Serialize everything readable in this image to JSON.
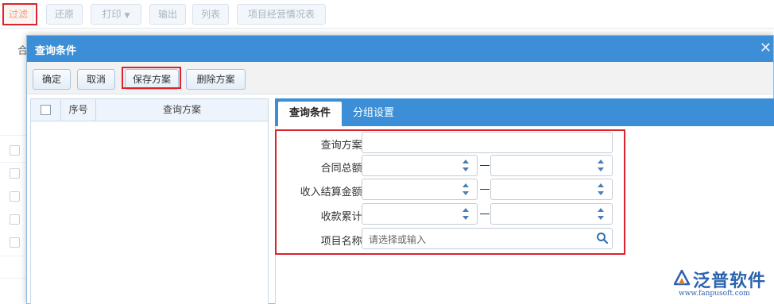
{
  "toolbar": {
    "filter": "过滤",
    "restore": "还原",
    "print": "打印",
    "export": "输出",
    "list": "列表",
    "report": "项目经营情况表"
  },
  "background": {
    "partial_text": "合"
  },
  "dialog": {
    "title": "查询条件",
    "buttons": {
      "confirm": "确定",
      "cancel": "取消",
      "save_scheme": "保存方案",
      "delete_scheme": "删除方案"
    },
    "left_table": {
      "columns": [
        "序号",
        "查询方案"
      ]
    },
    "tabs": [
      "查询条件",
      "分组设置"
    ],
    "active_tab": "查询条件",
    "form": {
      "scheme_label": "查询方案:",
      "scheme_value": "",
      "contract_total_label": "合同总额:",
      "income_settlement_label": "收入结算金额:",
      "collection_total_label": "收款累计:",
      "range_separator": "—",
      "project_name_label": "项目名称:",
      "project_name_placeholder": "请选择或输入"
    }
  },
  "logo": {
    "name": "泛普软件",
    "url": "www.fanpusoft.com"
  },
  "colors": {
    "primary": "#3c8fd6",
    "highlight_border": "#d9232d",
    "logo": "#2c63ae"
  }
}
